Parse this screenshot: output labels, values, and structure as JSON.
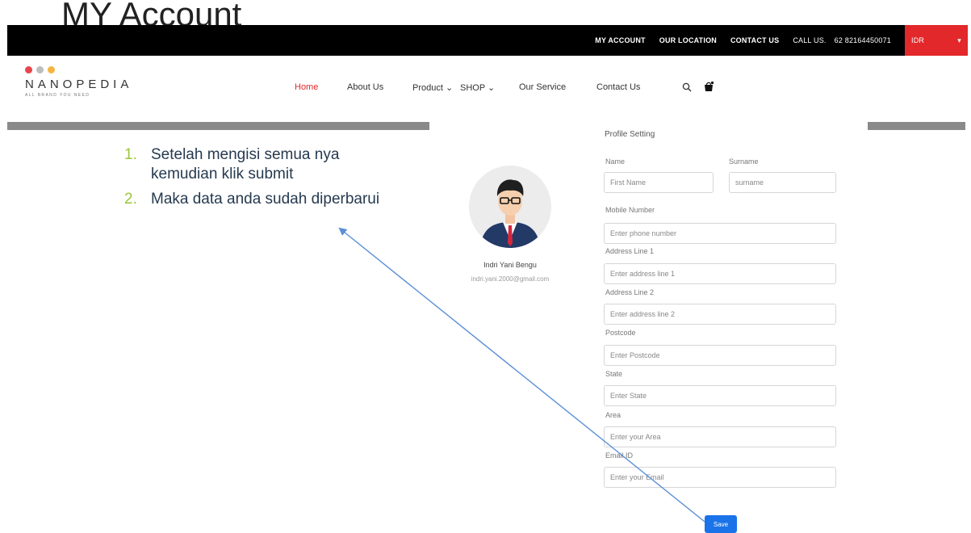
{
  "slide": {
    "title": "MY Account"
  },
  "topbar": {
    "my_account": "MY ACCOUNT",
    "our_location": "OUR LOCATION",
    "contact_us": "CONTACT US",
    "call_us_label": "CALL US.",
    "phone": "62 82164450071",
    "currency": "IDR",
    "currency_caret": "▾"
  },
  "brand": {
    "name": "NANOPEDIA",
    "tagline": "ALL BRAND YOU NEED",
    "dot_colors": [
      "#e8444a",
      "#bdbdbd",
      "#f4b63f"
    ]
  },
  "nav": {
    "items": [
      {
        "label": "Home",
        "active": true
      },
      {
        "label": "About Us"
      },
      {
        "label": "Product ⌄"
      },
      {
        "label": "SHOP ⌄"
      },
      {
        "label": "Our Service"
      },
      {
        "label": "Contact Us"
      }
    ],
    "icons": [
      "search-icon",
      "cart-icon"
    ]
  },
  "steps": [
    {
      "num": "1.",
      "text": "Setelah mengisi semua nya kemudian klik submit"
    },
    {
      "num": "2.",
      "text": "Maka data anda sudah diperbarui"
    }
  ],
  "profile": {
    "name": "Indri Yani Bengu",
    "email": "indri.yani.2000@gmail.com"
  },
  "form": {
    "title": "Profile Setting",
    "name_label": "Name",
    "name_placeholder": "First Name",
    "surname_label": "Surname",
    "surname_placeholder": "surname",
    "mobile_label": "Mobile Number",
    "mobile_placeholder": "Enter phone number",
    "addr1_label": "Address Line 1",
    "addr1_placeholder": "Enter address line 1",
    "addr2_label": "Address Line 2",
    "addr2_placeholder": "Enter address line 2",
    "postcode_label": "Postcode",
    "postcode_placeholder": "Enter Postcode",
    "state_label": "State",
    "state_placeholder": "Enter State",
    "area_label": "Area",
    "area_placeholder": "Enter your Area",
    "email_label": "Email ID",
    "email_placeholder": "Enter your Email",
    "save_label": "Save"
  },
  "colors": {
    "accent_red": "#e2282a",
    "save_blue": "#1a73e8",
    "step_number": "#9bc53d",
    "arrow": "#5b8fd6"
  }
}
